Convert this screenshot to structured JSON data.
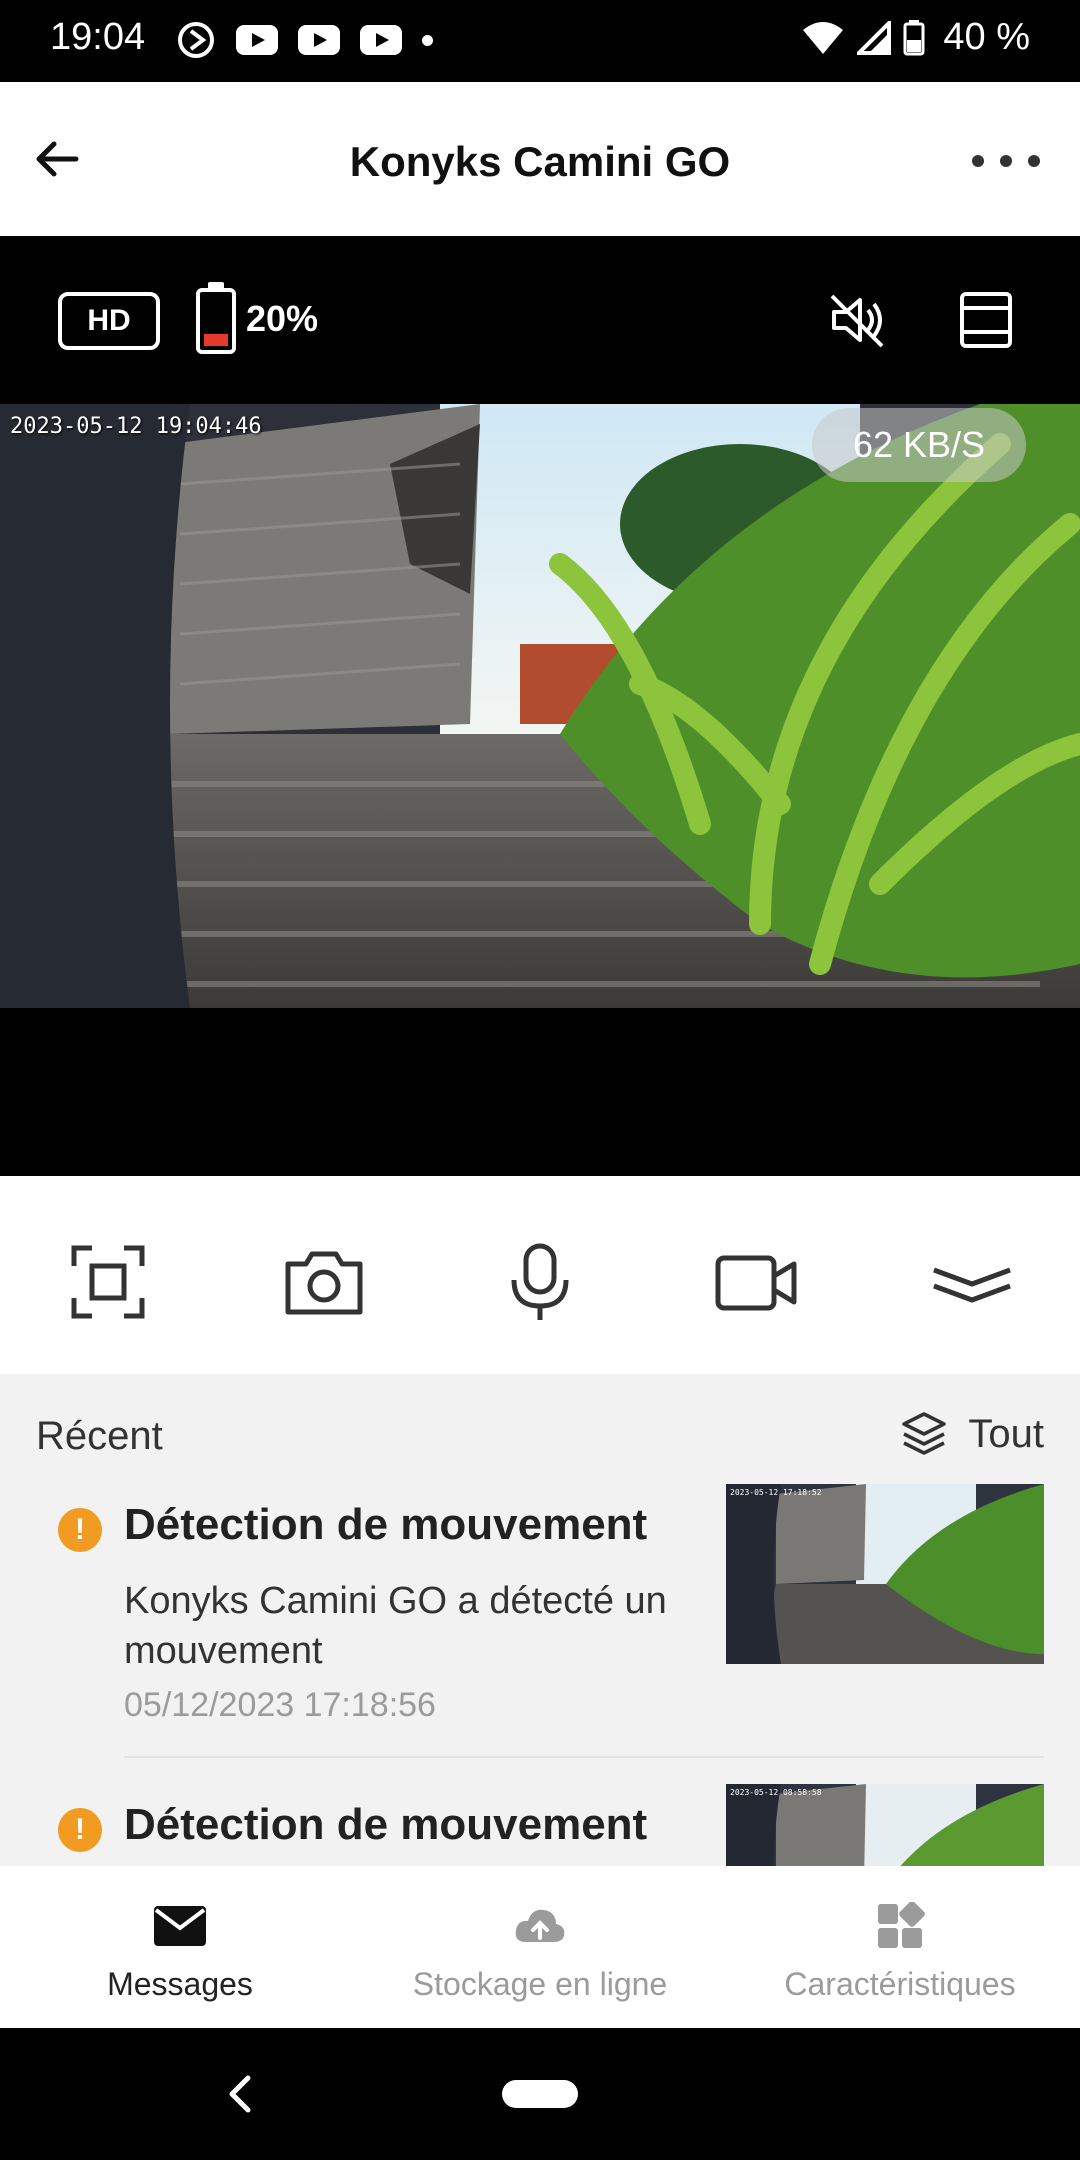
{
  "status_bar": {
    "time": "19:04",
    "battery_text": "40 %",
    "icons": [
      "assistant-icon",
      "youtube-icon",
      "youtube-icon",
      "youtube-icon",
      "dot-icon",
      "wifi-icon",
      "signal-icon",
      "battery-icon"
    ]
  },
  "header": {
    "title": "Konyks Camini GO",
    "back_icon": "back-arrow-icon",
    "more_icon": "more-horizontal-icon"
  },
  "camera": {
    "quality_label": "HD",
    "battery_percent": "20%",
    "battery_color": "#e53a2b",
    "timestamp": "2023-05-12 19:04:46",
    "bitrate": "62 KB/S"
  },
  "controls": [
    "fullscreen-icon",
    "camera-snapshot-icon",
    "microphone-icon",
    "video-record-icon",
    "expand-chevron-icon"
  ],
  "recent": {
    "title": "Récent",
    "filter_label": "Tout",
    "events": [
      {
        "title": "Détection de mouvement",
        "description": "Konyks Camini GO  a détecté un mouvement",
        "time": "05/12/2023 17:18:56",
        "thumb_timestamp": "2023-05-12 17:18:52"
      },
      {
        "title": "Détection de mouvement",
        "thumb_timestamp": "2023-05-12 08:58:58"
      }
    ]
  },
  "bottom_nav": {
    "items": [
      {
        "label": "Messages",
        "icon": "envelope-icon",
        "active": true
      },
      {
        "label": "Stockage en ligne",
        "icon": "cloud-upload-icon",
        "active": false
      },
      {
        "label": "Caractéristiques",
        "icon": "grid-icon",
        "active": false
      }
    ]
  },
  "colors": {
    "accent_warning": "#f29b22",
    "active_text": "#222222",
    "inactive_text": "#9b9b9b"
  }
}
